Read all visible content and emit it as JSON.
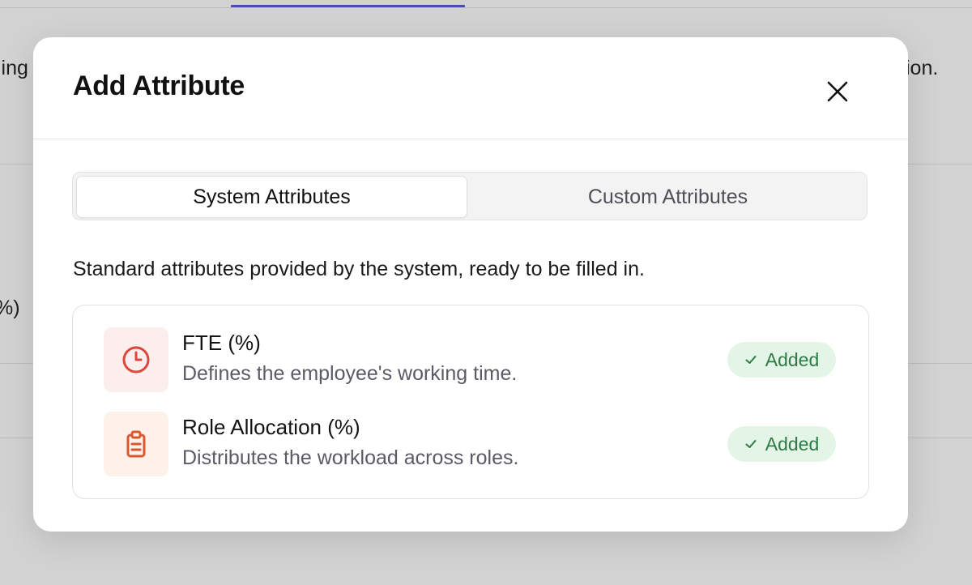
{
  "background": {
    "left_text_top": "ling",
    "right_text_top": "ion.",
    "left_text_mid": "%)"
  },
  "modal": {
    "title": "Add Attribute",
    "close_icon": "close-icon"
  },
  "tabs": [
    {
      "label": "System Attributes",
      "active": true
    },
    {
      "label": "Custom Attributes",
      "active": false
    }
  ],
  "description": "Standard attributes provided by the system, ready to be filled in.",
  "attributes": [
    {
      "name": "FTE (%)",
      "description": "Defines the employee's working time.",
      "icon": "clock-icon",
      "icon_color": "#d9483b",
      "icon_bg": "#fdeeee",
      "status": "Added"
    },
    {
      "name": "Role Allocation (%)",
      "description": "Distributes the workload across roles.",
      "icon": "clipboard-icon",
      "icon_color": "#d8582f",
      "icon_bg": "#fdf1ea",
      "status": "Added"
    }
  ],
  "colors": {
    "accent": "#4b4bb8",
    "badge_bg": "#e2f5e6",
    "badge_text": "#2f7a45"
  }
}
